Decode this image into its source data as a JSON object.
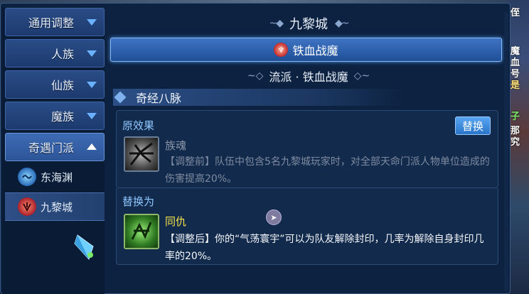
{
  "window": {
    "title": "九黎城"
  },
  "sidebar": {
    "items": [
      {
        "label": "通用调整",
        "state": "collapsed"
      },
      {
        "label": "人族",
        "state": "collapsed"
      },
      {
        "label": "仙族",
        "state": "collapsed"
      },
      {
        "label": "魔族",
        "state": "collapsed"
      },
      {
        "label": "奇遇门派",
        "state": "expanded"
      }
    ],
    "sub_items": [
      {
        "label": "东海渊",
        "icon": "wave-emblem-icon",
        "selected": false
      },
      {
        "label": "九黎城",
        "icon": "demon-emblem-icon",
        "selected": true
      }
    ]
  },
  "main": {
    "banner_label": "铁血战魔",
    "school_label": "流派 · 铁血战魔",
    "section_title": "奇经八脉",
    "original": {
      "label": "原效果",
      "replace_button": "替换",
      "skill_name": "族魂",
      "skill_icon": "shadow-claw-icon",
      "description": "【调整前】队伍中包含5名九黎城玩家时，对全部天命门派人物单位造成的伤害提高20%。"
    },
    "replacement": {
      "label": "替换为",
      "skill_name": "同仇",
      "skill_icon": "green-rune-icon",
      "description": "【调整后】你的“气荡寰宇”可以为队友解除封印，几率为解除自身封印几率的20%。"
    }
  },
  "scene": {
    "right_text": [
      "侄",
      "魔",
      "血",
      "号",
      "是",
      "子",
      "那",
      "究"
    ]
  },
  "colors": {
    "accent": "#3f74c4",
    "label_blue": "#8fc8ff",
    "skill_yellow": "#f3e04a",
    "disabled_gray": "#7e8ba0"
  }
}
